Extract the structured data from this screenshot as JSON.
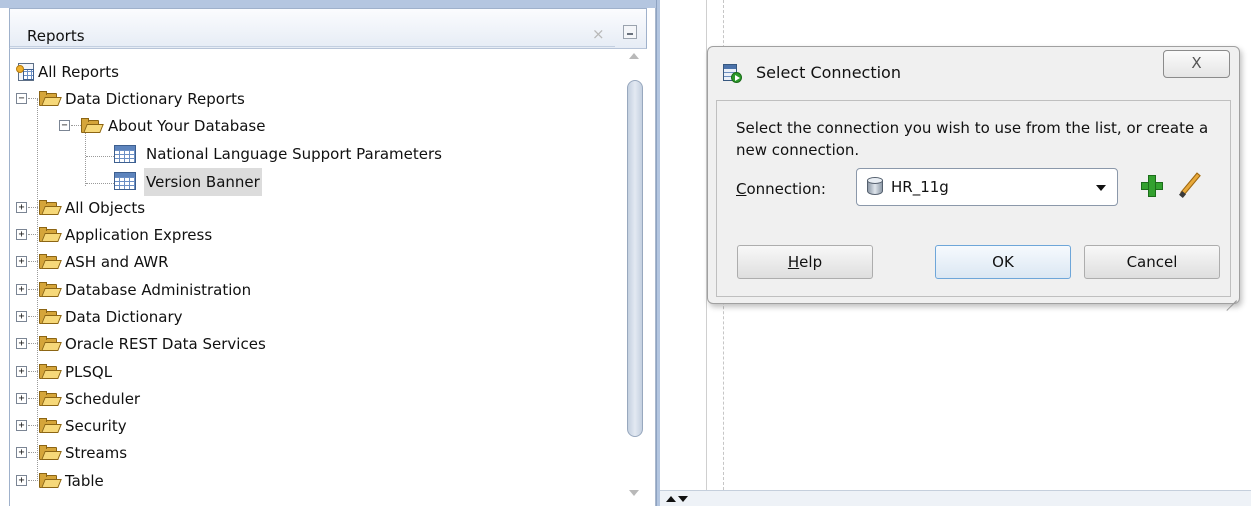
{
  "reports_panel": {
    "title": "Reports",
    "close_glyph": "×",
    "tree": [
      {
        "label": "All Reports",
        "icon": "all-reports-icon",
        "expander": ""
      },
      {
        "label": "Data Dictionary Reports",
        "icon": "folder-icon",
        "expander": "−"
      },
      {
        "label": "About Your Database",
        "icon": "folder-icon",
        "expander": "−"
      },
      {
        "label": "National Language Support Parameters",
        "icon": "report-table-icon",
        "expander": ""
      },
      {
        "label": "Version Banner",
        "icon": "report-table-icon",
        "expander": "",
        "selected": true
      },
      {
        "label": "All Objects",
        "icon": "folder-icon",
        "expander": "+"
      },
      {
        "label": "Application Express",
        "icon": "folder-icon",
        "expander": "+"
      },
      {
        "label": "ASH and AWR",
        "icon": "folder-icon",
        "expander": "+"
      },
      {
        "label": "Database Administration",
        "icon": "folder-icon",
        "expander": "+"
      },
      {
        "label": "Data Dictionary",
        "icon": "folder-icon",
        "expander": "+"
      },
      {
        "label": "Oracle REST Data Services",
        "icon": "folder-icon",
        "expander": "+"
      },
      {
        "label": "PLSQL",
        "icon": "folder-icon",
        "expander": "+"
      },
      {
        "label": "Scheduler",
        "icon": "folder-icon",
        "expander": "+"
      },
      {
        "label": "Security",
        "icon": "folder-icon",
        "expander": "+"
      },
      {
        "label": "Streams",
        "icon": "folder-icon",
        "expander": "+"
      },
      {
        "label": "Table",
        "icon": "folder-icon",
        "expander": "+"
      }
    ]
  },
  "dialog": {
    "title": "Select Connection",
    "close_glyph": "X",
    "instruction": "Select the connection you wish to use from the list, or create a new connection.",
    "connection_label_mnemonic": "C",
    "connection_label_rest": "onnection:",
    "connection_value": "HR_11g",
    "buttons": {
      "help_mnemonic": "H",
      "help_rest": "elp",
      "ok": "OK",
      "cancel": "Cancel"
    }
  },
  "colors": {
    "panel_border": "#9fb1cb",
    "splitter": "#b4c6e0",
    "selection": "#dcdcdc",
    "add_green": "#33a12f",
    "dialog_bg": "#f0f0f0"
  }
}
